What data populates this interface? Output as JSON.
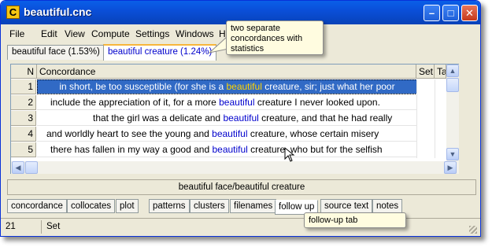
{
  "window": {
    "title": "beautiful.cnc",
    "app_icon_letter": "C",
    "minimize_glyph": "–",
    "maximize_glyph": "□",
    "close_glyph": "✕"
  },
  "menu": [
    "File",
    "Edit",
    "View",
    "Compute",
    "Settings",
    "Windows",
    "He"
  ],
  "doc_tabs": [
    {
      "label": "beautiful face (1.53%)",
      "active": false
    },
    {
      "label": "beautiful creature (1.24%)",
      "active": true
    }
  ],
  "grid": {
    "columns": {
      "n": "N",
      "concordance": "Concordance",
      "set": "Set",
      "tag": "Tag"
    },
    "rows": [
      {
        "n": "1",
        "pre": "in short, be too susceptible (for she is a ",
        "kw": "beautiful",
        "post": " creature, sir; just what her poor",
        "selected": true
      },
      {
        "n": "2",
        "pre": "include the appreciation of it, for a more ",
        "kw": "beautiful",
        "post": " creature I never looked upon.",
        "selected": false
      },
      {
        "n": "3",
        "pre": "that the girl was a delicate and ",
        "kw": "beautiful",
        "post": " creature, and that he had really",
        "selected": false
      },
      {
        "n": "4",
        "pre": "and worldly heart to see the young and ",
        "kw": "beautiful",
        "post": " creature, whose certain misery",
        "selected": false
      },
      {
        "n": "5",
        "pre": "there has fallen in my way a good and ",
        "kw": "beautiful",
        "post": " creature, who but for the selfish",
        "selected": false
      }
    ]
  },
  "caption": "beautiful face/beautiful creature",
  "bottom_tabs": [
    {
      "label": "concordance",
      "active": false
    },
    {
      "label": "collocates",
      "active": false
    },
    {
      "label": "plot",
      "active": false
    },
    {
      "label": "patterns",
      "active": false
    },
    {
      "label": "clusters",
      "active": false
    },
    {
      "label": "filenames",
      "active": false
    },
    {
      "label": "follow up",
      "active": true
    },
    {
      "label": "source text",
      "active": false
    },
    {
      "label": "notes",
      "active": false
    }
  ],
  "status": {
    "count": "21",
    "mode": "Set"
  },
  "callouts": {
    "top": "two separate concordances with statistics",
    "bottom": "follow-up tab"
  },
  "colors": {
    "keyword": "#0000cc",
    "keyword_selected": "#ffd400",
    "selection": "#316ac5",
    "titlebar": "#0a4fd9"
  }
}
